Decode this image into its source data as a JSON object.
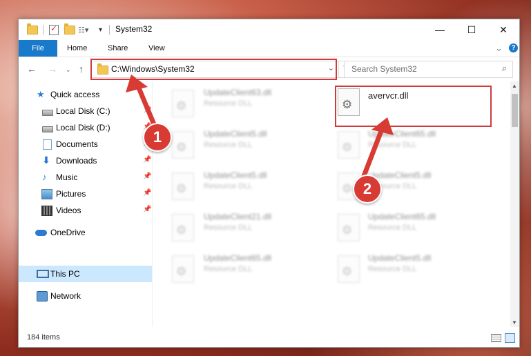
{
  "window": {
    "title": "System32",
    "controls": {
      "minimize": "—",
      "maximize": "☐",
      "close": "✕"
    }
  },
  "ribbon": {
    "tabs": [
      "File",
      "Home",
      "Share",
      "View"
    ],
    "expand_icon": "⌄",
    "help_icon": "?"
  },
  "addressbar": {
    "path": "C:\\Windows\\System32",
    "search_placeholder": "Search System32"
  },
  "sidebar": {
    "items": [
      {
        "label": "Quick access",
        "icon": "star-icon"
      },
      {
        "label": "Local Disk (C:)",
        "icon": "drive-icon",
        "pinned": true
      },
      {
        "label": "Local Disk (D:)",
        "icon": "drive-icon",
        "pinned": true
      },
      {
        "label": "Documents",
        "icon": "document-icon",
        "pinned": true
      },
      {
        "label": "Downloads",
        "icon": "download-icon",
        "pinned": true
      },
      {
        "label": "Music",
        "icon": "music-icon",
        "pinned": true
      },
      {
        "label": "Pictures",
        "icon": "pictures-icon",
        "pinned": true
      },
      {
        "label": "Videos",
        "icon": "videos-icon",
        "pinned": true
      },
      {
        "label": "OneDrive",
        "icon": "cloud-icon"
      },
      {
        "label": "This PC",
        "icon": "pc-icon",
        "selected": true
      },
      {
        "label": "Network",
        "icon": "network-icon"
      }
    ]
  },
  "files": {
    "highlighted": {
      "name": "avervcr.dll",
      "type": ""
    },
    "blurred": [
      {
        "name": "UpdateClient63.dll",
        "type": "Resource DLL"
      },
      {
        "name": "UpdateClient5.dll",
        "type": "Resource DLL"
      },
      {
        "name": "UpdateClient65.dll",
        "type": "Resource DLL"
      },
      {
        "name": "UpdateClient5.dll",
        "type": "Resource DLL"
      },
      {
        "name": "UpdateClient5.dll",
        "type": "Resource DLL"
      },
      {
        "name": "UpdateClient21.dll",
        "type": "Resource DLL"
      },
      {
        "name": "UpdateClient65.dll",
        "type": "Resource DLL"
      },
      {
        "name": "UpdateClient65.dll",
        "type": "Resource DLL"
      },
      {
        "name": "UpdateClient5.dll",
        "type": "Resource DLL"
      }
    ]
  },
  "status": {
    "item_count": "184 items"
  },
  "annotations": {
    "step1": "1",
    "step2": "2",
    "color": "#d73b34"
  }
}
